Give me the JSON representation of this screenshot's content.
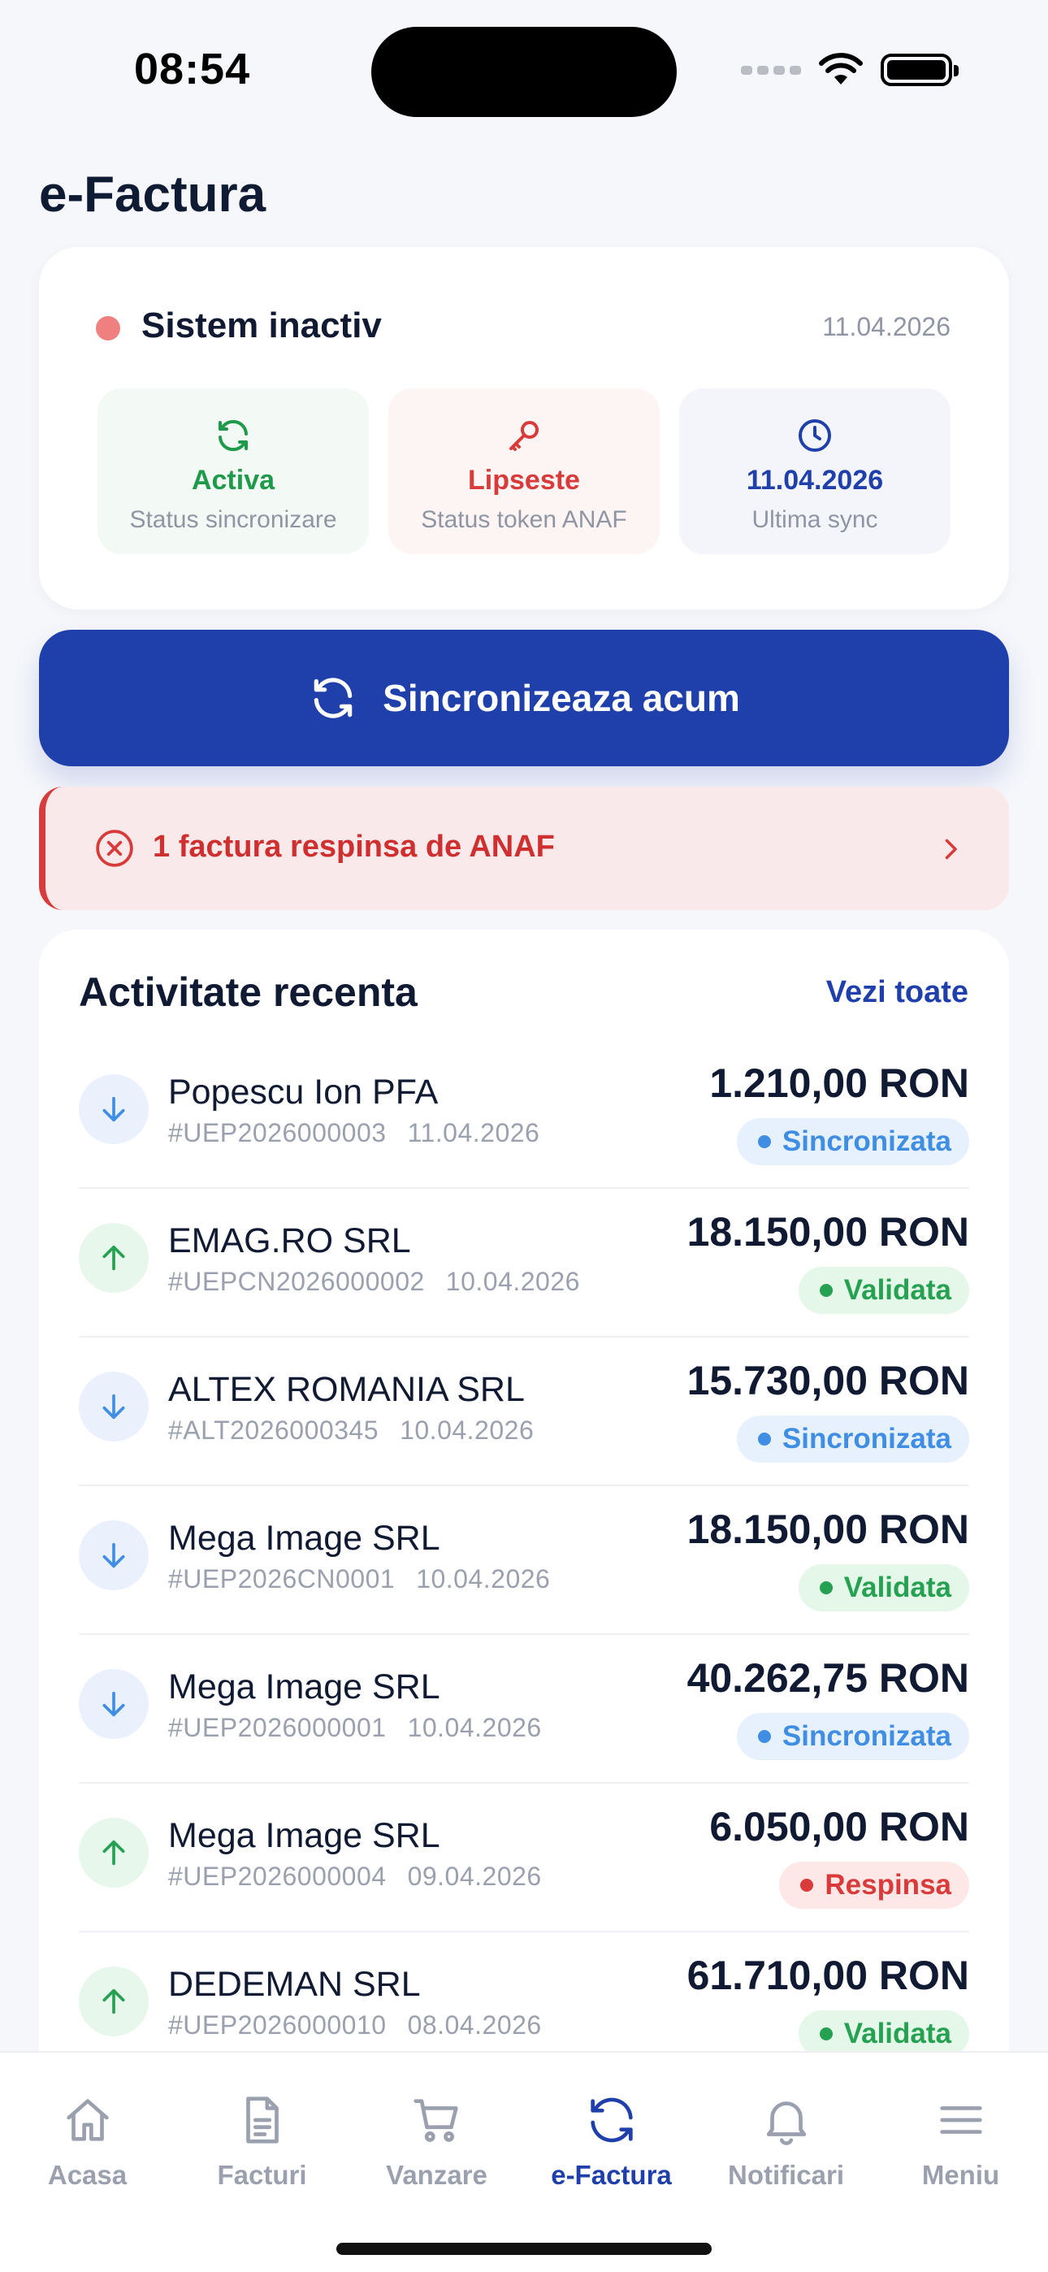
{
  "status_bar": {
    "time": "08:54"
  },
  "page": {
    "title": "e-Factura"
  },
  "system": {
    "label": "Sistem inactiv",
    "date": "11.04.2026",
    "colors": {
      "inactive_dot": "#f07f80"
    },
    "tiles": [
      {
        "icon": "refresh-icon",
        "value": "Activa",
        "label": "Status sincronizare",
        "color": "#1f9a4a"
      },
      {
        "icon": "key-icon",
        "value": "Lipseste",
        "label": "Status token ANAF",
        "color": "#d93a3a"
      },
      {
        "icon": "clock-icon",
        "value": "11.04.2026",
        "label": "Ultima sync",
        "color": "#1f3fab"
      }
    ]
  },
  "sync_button": {
    "label": "Sincronizeaza acum",
    "icon": "refresh-icon",
    "color": "#1f3fab"
  },
  "alert": {
    "text": "1 factura respinsa de ANAF",
    "icon": "error-circle-icon",
    "color": "#cf2f2f"
  },
  "activity": {
    "title": "Activitate recenta",
    "see_all": "Vezi toate",
    "items": [
      {
        "direction": "in",
        "name": "Popescu Ion PFA",
        "number": "#UEP2026000003",
        "date": "11.04.2026",
        "amount": "1.210,00 RON",
        "status": "Sincronizata",
        "status_type": "sync"
      },
      {
        "direction": "out",
        "name": "EMAG.RO SRL",
        "number": "#UEPCN2026000002",
        "date": "10.04.2026",
        "amount": "18.150,00 RON",
        "status": "Validata",
        "status_type": "valid"
      },
      {
        "direction": "in",
        "name": "ALTEX ROMANIA SRL",
        "number": "#ALT2026000345",
        "date": "10.04.2026",
        "amount": "15.730,00 RON",
        "status": "Sincronizata",
        "status_type": "sync"
      },
      {
        "direction": "in",
        "name": "Mega Image SRL",
        "number": "#UEP2026CN0001",
        "date": "10.04.2026",
        "amount": "18.150,00 RON",
        "status": "Validata",
        "status_type": "valid"
      },
      {
        "direction": "in",
        "name": "Mega Image SRL",
        "number": "#UEP2026000001",
        "date": "10.04.2026",
        "amount": "40.262,75 RON",
        "status": "Sincronizata",
        "status_type": "sync"
      },
      {
        "direction": "out",
        "name": "Mega Image SRL",
        "number": "#UEP2026000004",
        "date": "09.04.2026",
        "amount": "6.050,00 RON",
        "status": "Respinsa",
        "status_type": "rej"
      },
      {
        "direction": "out",
        "name": "DEDEMAN SRL",
        "number": "#UEP2026000010",
        "date": "08.04.2026",
        "amount": "61.710,00 RON",
        "status": "Validata",
        "status_type": "valid"
      }
    ]
  },
  "tabbar": {
    "items": [
      {
        "label": "Acasa",
        "icon": "home-icon",
        "active": false
      },
      {
        "label": "Facturi",
        "icon": "document-icon",
        "active": false
      },
      {
        "label": "Vanzare",
        "icon": "cart-icon",
        "active": false
      },
      {
        "label": "e-Factura",
        "icon": "refresh-icon",
        "active": true
      },
      {
        "label": "Notificari",
        "icon": "bell-icon",
        "active": false
      },
      {
        "label": "Meniu",
        "icon": "menu-icon",
        "active": false
      }
    ],
    "colors": {
      "active": "#1f3fab",
      "inactive": "#9aa0ad"
    }
  }
}
